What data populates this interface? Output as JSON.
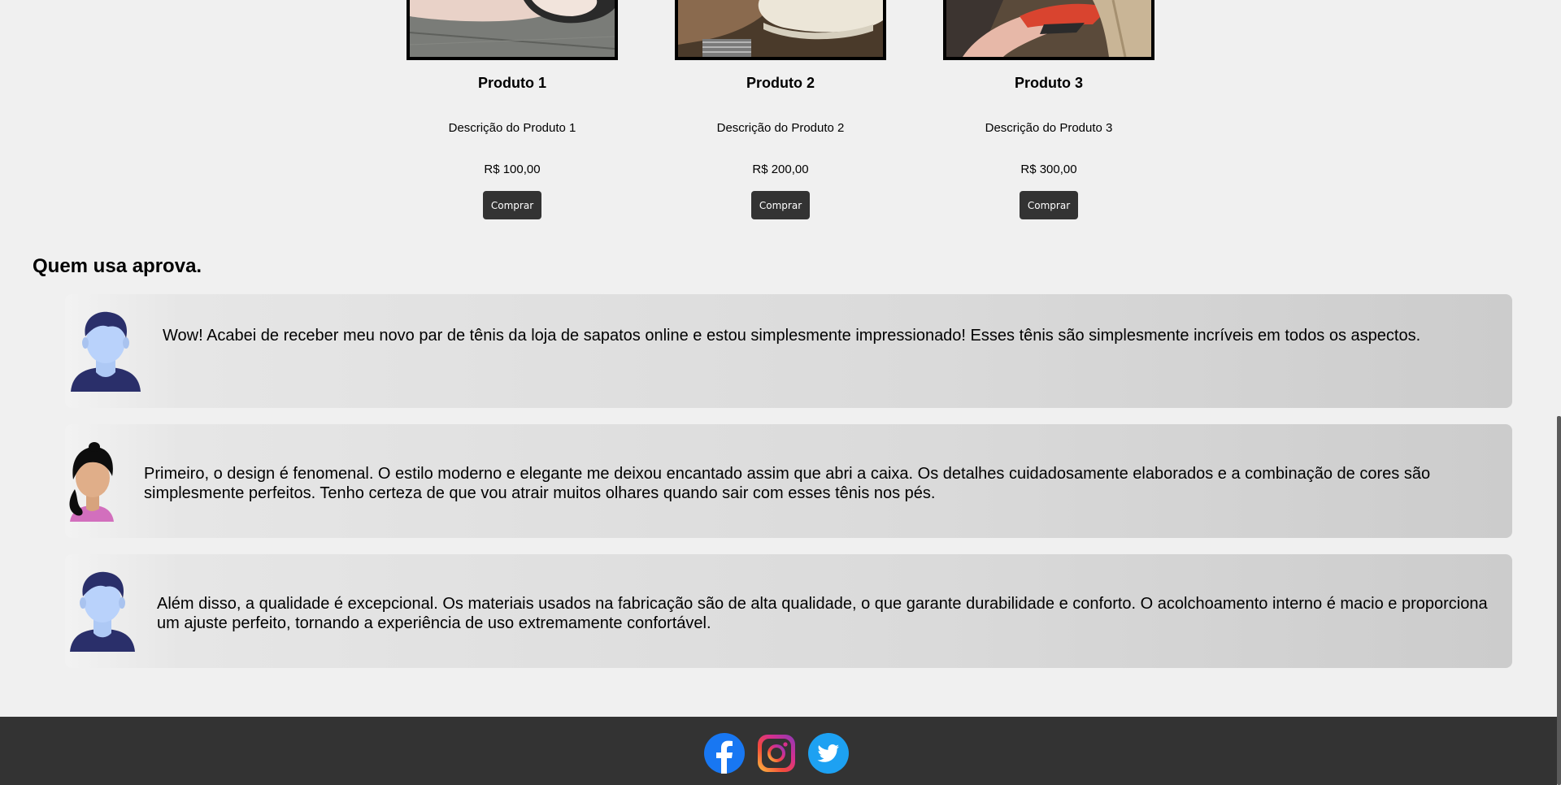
{
  "products": [
    {
      "title": "Produto 1",
      "description": "Descrição do Produto 1",
      "price": "R$ 100,00",
      "buy_label": "Comprar"
    },
    {
      "title": "Produto 2",
      "description": "Descrição do Produto 2",
      "price": "R$ 200,00",
      "buy_label": "Comprar"
    },
    {
      "title": "Produto 3",
      "description": "Descrição do Produto 3",
      "price": "R$ 300,00",
      "buy_label": "Comprar"
    }
  ],
  "testimonials_section": {
    "title": "Quem usa aprova.",
    "items": [
      {
        "avatar": "male-avatar-icon",
        "text": "Wow! Acabei de receber meu novo par de tênis da loja de sapatos online e estou simplesmente impressionado! Esses tênis são simplesmente incríveis em todos os aspectos."
      },
      {
        "avatar": "female-avatar-icon",
        "text": "Primeiro, o design é fenomenal. O estilo moderno e elegante me deixou encantado assim que abri a caixa. Os detalhes cuidadosamente elaborados e a combinação de cores são simplesmente perfeitos. Tenho certeza de que vou atrair muitos olhares quando sair com esses tênis nos pés."
      },
      {
        "avatar": "male-avatar-icon",
        "text": "Além disso, a qualidade é excepcional. Os materiais usados na fabricação são de alta qualidade, o que garante durabilidade e conforto. O acolchoamento interno é macio e proporciona um ajuste perfeito, tornando a experiência de uso extremamente confortável."
      }
    ]
  },
  "footer": {
    "social_icons": [
      "facebook-icon",
      "instagram-icon",
      "twitter-icon"
    ]
  },
  "colors": {
    "page_background": "#f0f0f0",
    "footer_background": "#333333",
    "button_background": "#333333",
    "facebook": "#1877f2",
    "twitter": "#1da1f2"
  }
}
